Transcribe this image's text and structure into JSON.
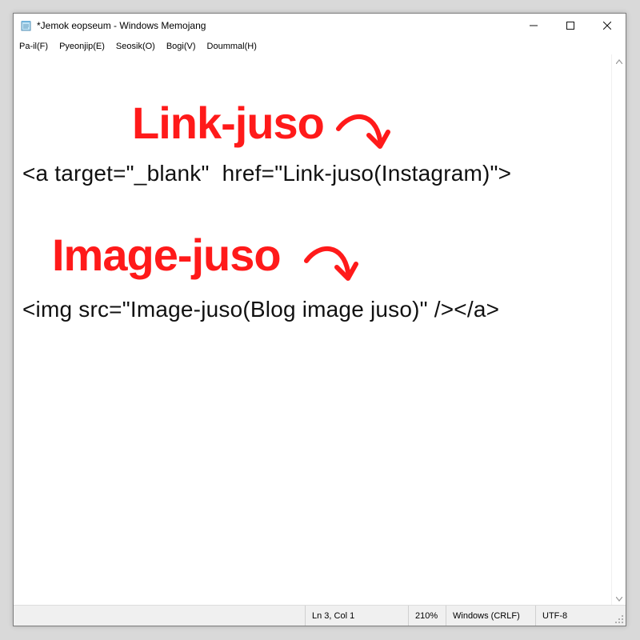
{
  "window": {
    "title": "*Jemok eopseum - Windows Memojang",
    "controls": {
      "minimize": "—",
      "maximize": "☐",
      "close": "✕"
    }
  },
  "menu": [
    {
      "label": "Pa-il(F)"
    },
    {
      "label": "Pyeonjip(E)"
    },
    {
      "label": "Seosik(O)"
    },
    {
      "label": "Bogi(V)"
    },
    {
      "label": "Doummal(H)"
    }
  ],
  "annotations": {
    "link_label": "Link-juso",
    "image_label": "Image-juso",
    "color": "#ff1a1a"
  },
  "content": {
    "line1": "<a target=\"_blank\"  href=\"Link-juso(Instagram)\">",
    "line2": "<img src=\"Image-juso(Blog image juso)\" /></a>"
  },
  "status": {
    "position": "Ln 3, Col 1",
    "zoom": "210%",
    "line_ending": "Windows (CRLF)",
    "encoding": "UTF-8"
  }
}
